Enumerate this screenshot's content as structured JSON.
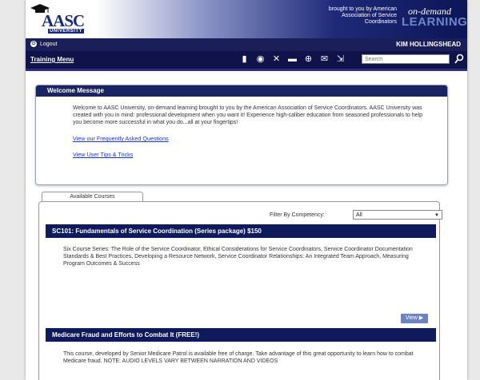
{
  "header": {
    "logo": "AASC",
    "logo_sub": "UNIVERSITY",
    "brought_by": "brought to you by American Association of Service Coordinators",
    "ondemand_1": "on-demand",
    "ondemand_2": "LEARNING"
  },
  "topbar": {
    "logout_label": "Logout",
    "user_name": "KIM HOLLINGSHEAD"
  },
  "menubar": {
    "training_menu": "Training Menu",
    "search_placeholder": "Search",
    "icons": [
      "book-icon",
      "speech-bubble-icon",
      "tools-icon",
      "document-icon",
      "lifebuoy-icon",
      "mail-icon",
      "export-icon"
    ]
  },
  "welcome": {
    "title": "Welcome Message",
    "body": "Welcome to AASC University, on-demand learning brought to you by the American Association of Service Coordinators. AASC University was created with you in mind: professional development when you want it! Experience high-caliber education from seasoned professionals to help you become more successful in what you do...all at your fingertips!",
    "faq_link": "View our Frequently Asked Questions",
    "tips_link": "View User Tips & Tricks"
  },
  "courses": {
    "tab_label": "Available Courses",
    "filter_label": "Filter By Competency:",
    "filter_value": "All",
    "items": [
      {
        "title": "SC101: Fundamentals of Service Coordination (Series package) $150",
        "description": "Six Course Series: The Role of the Service Coordinator, Ethical Considerations for Service Coordinators, Service Coordinator Documentation Standards & Best Practices, Developing a Resource Network, Service Coordinator Relationships: An Integrated Team Approach, Measuring Program Outcomes & Success",
        "view_label": "View ▶"
      },
      {
        "title": "Medicare Fraud and Efforts to Combat It (FREE!)",
        "description": "This course, developed by Senior Medicare Patrol is available free of charge. Take advantage of this great opportunity to learn how to combat Medicare fraud. NOTE: AUDIO LEVELS VARY BETWEEN NARRATION AND VIDEOS"
      }
    ]
  },
  "colors": {
    "navy": "#10134a",
    "header_blue": "#1a2462",
    "link_blue": "#1e36c8",
    "view_button": "#6c82c2"
  }
}
